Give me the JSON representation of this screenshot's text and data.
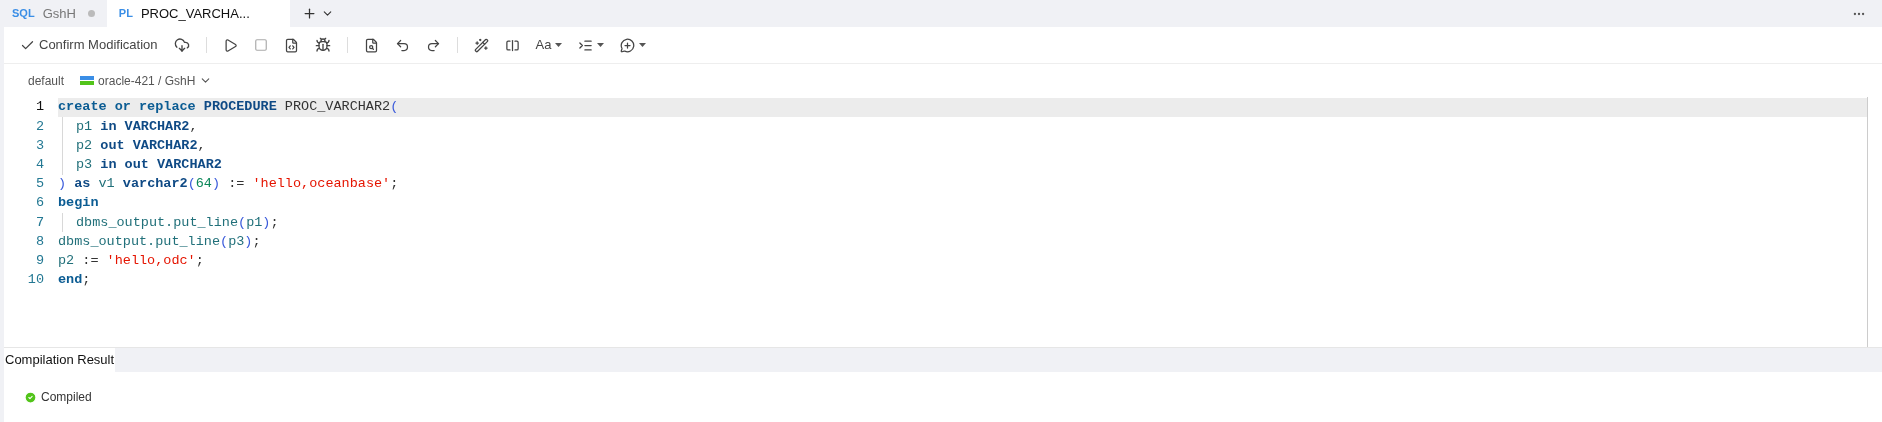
{
  "tabs": [
    {
      "badge": "SQL",
      "label": "GshH",
      "selected": false,
      "unsaved": true
    },
    {
      "badge": "PL",
      "label": "PROC_VARCHA...",
      "selected": true,
      "unsaved": false
    }
  ],
  "toolbar": {
    "confirm_label": "Confirm Modification",
    "font_label": "Aa"
  },
  "connection": {
    "schema": "default",
    "datasource": "oracle-421 / GshH"
  },
  "editor": {
    "lines": [
      {
        "number": "1",
        "current": true,
        "indent": false,
        "tokens": [
          {
            "kind": "keyword",
            "text": "create or replace "
          },
          {
            "kind": "type",
            "text": "PROCEDURE "
          },
          {
            "kind": "plain",
            "text": "PROC_VARCHAR2"
          },
          {
            "kind": "paren",
            "text": "("
          }
        ]
      },
      {
        "number": "2",
        "current": false,
        "indent": true,
        "tokens": [
          {
            "kind": "ident",
            "text": "p1 "
          },
          {
            "kind": "type",
            "text": "in VARCHAR2"
          },
          {
            "kind": "plain",
            "text": ","
          }
        ]
      },
      {
        "number": "3",
        "current": false,
        "indent": true,
        "tokens": [
          {
            "kind": "ident",
            "text": "p2 "
          },
          {
            "kind": "type",
            "text": "out VARCHAR2"
          },
          {
            "kind": "plain",
            "text": ","
          }
        ]
      },
      {
        "number": "4",
        "current": false,
        "indent": true,
        "tokens": [
          {
            "kind": "ident",
            "text": "p3 "
          },
          {
            "kind": "type",
            "text": "in out VARCHAR2"
          }
        ]
      },
      {
        "number": "5",
        "current": false,
        "indent": false,
        "tokens": [
          {
            "kind": "paren",
            "text": ") "
          },
          {
            "kind": "type",
            "text": "as "
          },
          {
            "kind": "ident",
            "text": "v1 "
          },
          {
            "kind": "type",
            "text": "varchar2"
          },
          {
            "kind": "paren",
            "text": "("
          },
          {
            "kind": "number",
            "text": "64"
          },
          {
            "kind": "paren",
            "text": ")"
          },
          {
            "kind": "plain",
            "text": " := "
          },
          {
            "kind": "string",
            "text": "'hello,oceanbase'"
          },
          {
            "kind": "plain",
            "text": ";"
          }
        ]
      },
      {
        "number": "6",
        "current": false,
        "indent": false,
        "tokens": [
          {
            "kind": "keyword",
            "text": "begin"
          }
        ]
      },
      {
        "number": "7",
        "current": false,
        "indent": true,
        "tokens": [
          {
            "kind": "ident",
            "text": "dbms_output.put_line"
          },
          {
            "kind": "paren",
            "text": "("
          },
          {
            "kind": "ident",
            "text": "p1"
          },
          {
            "kind": "paren",
            "text": ")"
          },
          {
            "kind": "plain",
            "text": ";"
          }
        ]
      },
      {
        "number": "8",
        "current": false,
        "indent": false,
        "tokens": [
          {
            "kind": "ident",
            "text": "dbms_output.put_line"
          },
          {
            "kind": "paren",
            "text": "("
          },
          {
            "kind": "ident",
            "text": "p3"
          },
          {
            "kind": "paren",
            "text": ")"
          },
          {
            "kind": "plain",
            "text": ";"
          }
        ]
      },
      {
        "number": "9",
        "current": false,
        "indent": false,
        "tokens": [
          {
            "kind": "ident",
            "text": "p2"
          },
          {
            "kind": "plain",
            "text": " := "
          },
          {
            "kind": "string",
            "text": "'hello,odc'"
          },
          {
            "kind": "plain",
            "text": ";"
          }
        ]
      },
      {
        "number": "10",
        "current": false,
        "indent": false,
        "tokens": [
          {
            "kind": "keyword",
            "text": "end"
          },
          {
            "kind": "plain",
            "text": ";"
          }
        ]
      }
    ]
  },
  "result": {
    "tab": "Compilation Result",
    "status": "Compiled"
  }
}
